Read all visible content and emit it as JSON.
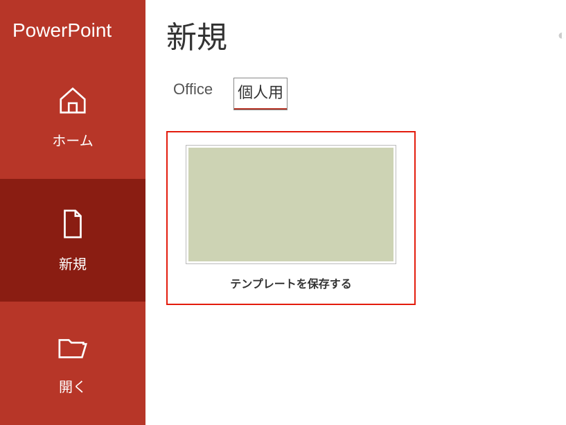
{
  "app_title": "PowerPoint",
  "sidebar": {
    "items": [
      {
        "label": "ホーム"
      },
      {
        "label": "新規"
      },
      {
        "label": "開く"
      }
    ]
  },
  "main": {
    "page_title": "新規",
    "tabs": [
      {
        "label": "Office"
      },
      {
        "label": "個人用"
      }
    ],
    "template": {
      "label": "テンプレートを保存する"
    }
  }
}
